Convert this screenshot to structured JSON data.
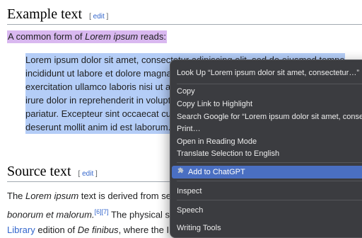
{
  "article": {
    "heading1": "Example text",
    "edit_label": "edit",
    "intro_prefix": "A common form of ",
    "intro_italic": "Lorem ipsum",
    "intro_suffix": " reads:",
    "quote_lines": [
      "Lorem ipsum dolor sit amet, consectetur adipiscing elit, sed do eiusmod tempor",
      "incididunt ut labore et dolore magna",
      "exercitation ullamco laboris nisi ut a",
      "irure dolor in reprehenderit in volupt",
      "pariatur. Excepteur sint occaecat cu",
      "deserunt mollit anim id est laborum."
    ],
    "heading2": "Source text",
    "para_line1_prefix": "The ",
    "para_line1_italic": "Lorem ipsum",
    "para_line1_suffix": " text is derived from se",
    "para_line2_italic": "bonorum et malorum.",
    "para_line2_ref1": "[6]",
    "para_line2_ref2": "[7]",
    "para_line2_suffix": " The physical s",
    "para_line3_link": "Library",
    "para_line3_mid": " edition of ",
    "para_line3_italic": "De finibus",
    "para_line3_suffix": ", where the I"
  },
  "context_menu": {
    "look_up": "Look Up “Lorem ipsum dolor sit amet, consectetur…”",
    "copy": "Copy",
    "copy_link": "Copy Link to Highlight",
    "search_google": "Search Google for “Lorem ipsum dolor sit amet, conse",
    "print": "Print…",
    "reading_mode": "Open in Reading Mode",
    "translate": "Translate Selection to English",
    "add_chatgpt": "Add to ChatGPT",
    "inspect": "Inspect",
    "speech": "Speech",
    "writing_tools": "Writing Tools"
  },
  "colors": {
    "selection": "#b4cdf7",
    "intro_highlight": "#d9b8f0",
    "menu_highlight": "#4a6fc2",
    "link": "#3366cc"
  }
}
